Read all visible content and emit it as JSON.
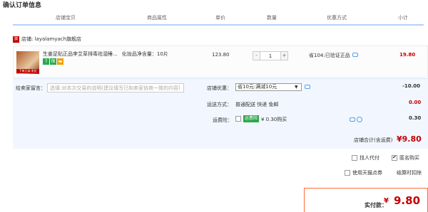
{
  "page_title": "确认订单信息",
  "columns": [
    "店铺宝贝",
    "商品属性",
    "单价",
    "数量",
    "优惠方式",
    "小计"
  ],
  "shop": {
    "icon_text": "旗",
    "label_prefix": "店铺:",
    "name": "layalamyach旗舰店"
  },
  "item": {
    "title": "生姜足贴正品李艾草排毒祛湿睡...",
    "attr": "化妆品净含量：10片",
    "price": "123.80",
    "qty": "1",
    "minus": "-",
    "plus": "+",
    "promo": "省104:已验证正品",
    "subtotal": "19.80",
    "thumb_text": "下单立减 发货"
  },
  "memo": {
    "label": "给卖家留言：",
    "placeholder": "选填:对本次交易的说明(建议填写已和卖家协商一致的内容)"
  },
  "shop_discount": {
    "label": "店铺优惠：",
    "selected": "省10元:满减10元",
    "amount": "-10.00"
  },
  "shipping": {
    "label": "运送方式：",
    "value": "普通配送 快递 免邮",
    "amount": "0.00"
  },
  "insurance": {
    "label": "运费险：",
    "badge": "运费险",
    "text": "¥ 0.30购买",
    "amount": "0.30"
  },
  "shop_total": {
    "label": "店铺合计(含运费)",
    "value": "¥9.80"
  },
  "options": {
    "proxy_pay": "找人代付",
    "anonymous": "匿名购买",
    "tmall_points": "使用天猫点券",
    "points_deduct": "结算时扣除"
  },
  "final": {
    "label": "实付款：",
    "currency": "¥",
    "amount": "9.80"
  },
  "colors": {
    "accent_red": "#c40000",
    "header_line": "#b2d1ff",
    "panel_bg": "#f2f7ff",
    "final_border": "#ff6a3a"
  }
}
